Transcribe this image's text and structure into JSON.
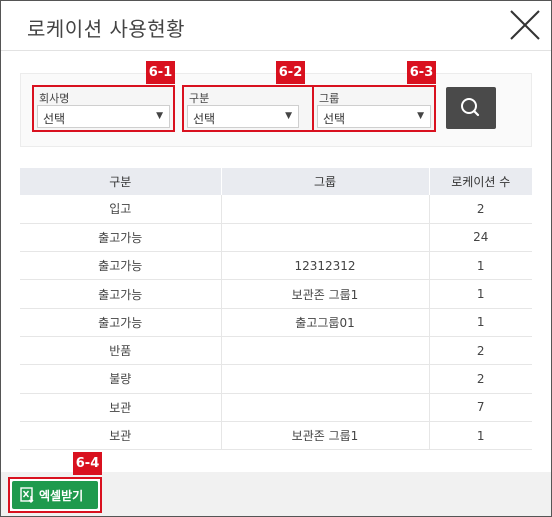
{
  "modal": {
    "title": "로케이션 사용현황",
    "close_icon": "close-icon"
  },
  "filters": [
    {
      "badge": "6-1",
      "label": "회사명",
      "value": "선택"
    },
    {
      "badge": "6-2",
      "label": "구분",
      "value": "선택"
    },
    {
      "badge": "6-3",
      "label": "그룹",
      "value": "선택"
    }
  ],
  "search_icon": "search-icon",
  "table": {
    "headers": [
      "구분",
      "그룹",
      "로케이션 수"
    ],
    "rows": [
      [
        "입고",
        "",
        "2"
      ],
      [
        "출고가능",
        "",
        "24"
      ],
      [
        "출고가능",
        "12312312",
        "1"
      ],
      [
        "출고가능",
        "보관존 그룹1",
        "1"
      ],
      [
        "출고가능",
        "출고그룹01",
        "1"
      ],
      [
        "반품",
        "",
        "2"
      ],
      [
        "불량",
        "",
        "2"
      ],
      [
        "보관",
        "",
        "7"
      ],
      [
        "보관",
        "보관존 그룹1",
        "1"
      ]
    ]
  },
  "footer": {
    "badge": "6-4",
    "excel_label": "엑셀받기",
    "excel_icon": "excel-download-icon"
  },
  "colors": {
    "highlight": "#d9111f",
    "excel_button": "#1f9a4d",
    "search_button": "#4a4a4a",
    "table_header": "#e9ebf0"
  }
}
